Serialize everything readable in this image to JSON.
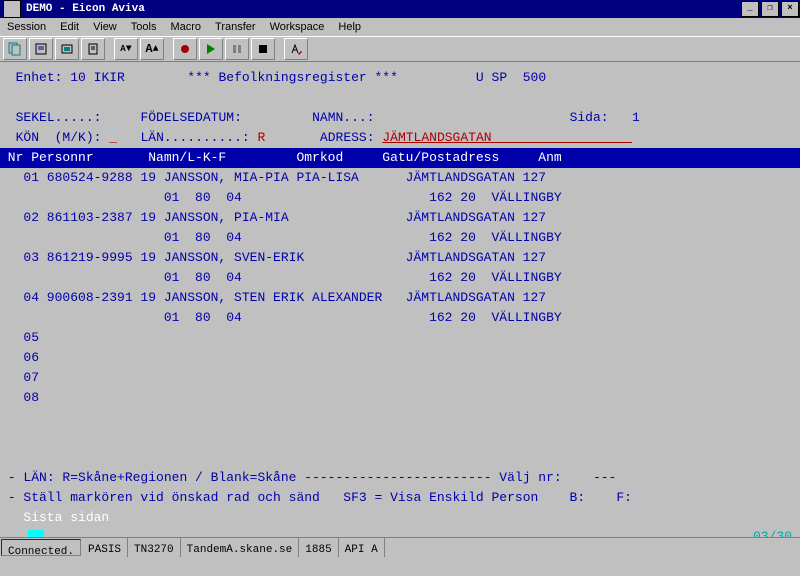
{
  "window": {
    "title": "DEMO - Eicon Aviva"
  },
  "menu": [
    "Session",
    "Edit",
    "View",
    "Tools",
    "Macro",
    "Transfer",
    "Workspace",
    "Help"
  ],
  "hdrline": {
    "enhet_l": "Enhet:",
    "enhet_v": "10 IKIR",
    "center": "*** Befolkningsregister ***",
    "right": "U SP  500"
  },
  "f1": {
    "sekel": "SEKEL.....:",
    "fdatum": "FÖDELSEDATUM:",
    "namn": "NAMN...:",
    "sida_l": "Sida:",
    "sida_v": "1"
  },
  "f2": {
    "kon": "KÖN  (M/K):",
    "lan_l": "LÄN..........:",
    "lan_v": "R",
    "adr_l": "ADRESS:",
    "adr_v": "JÄMTLANDSGATAN"
  },
  "colhdr": " Nr Personnr       Namn/L-K-F         Omrkod     Gatu/Postadress     Anm ",
  "rows": [
    {
      "n": "01",
      "pn": "680524-9288",
      "kod": "19",
      "namn": "JANSSON, MIA-PIA PIA-LISA",
      "adr": "JÄMTLANDSGATAN 127",
      "sub": "01  80  04",
      "post": "162 20  VÄLLINGBY"
    },
    {
      "n": "02",
      "pn": "861103-2387",
      "kod": "19",
      "namn": "JANSSON, PIA-MIA",
      "adr": "JÄMTLANDSGATAN 127",
      "sub": "01  80  04",
      "post": "162 20  VÄLLINGBY"
    },
    {
      "n": "03",
      "pn": "861219-9995",
      "kod": "19",
      "namn": "JANSSON, SVEN-ERIK",
      "adr": "JÄMTLANDSGATAN 127",
      "sub": "01  80  04",
      "post": "162 20  VÄLLINGBY"
    },
    {
      "n": "04",
      "pn": "900608-2391",
      "kod": "19",
      "namn": "JANSSON, STEN ERIK ALEXANDER",
      "adr": "JÄMTLANDSGATAN 127",
      "sub": "01  80  04",
      "post": "162 20  VÄLLINGBY"
    },
    {
      "n": "05"
    },
    {
      "n": "06"
    },
    {
      "n": "07"
    },
    {
      "n": "08"
    }
  ],
  "foot1": {
    "pre": "- LÄN: R=Skåne+Regionen / Blank=Skåne ------------------------ Välj nr:",
    "dash": "---"
  },
  "foot2": {
    "txt": "- Ställ markören vid önskad rad och sänd   SF3 = Visa Enskild Person",
    "b": "B:",
    "f": "F:"
  },
  "foot3": "   Sista sidan",
  "pos": "03/30",
  "status": [
    "Connected.",
    "PASIS",
    "TN3270",
    "TandemA.skane.se",
    "1885",
    "API A"
  ]
}
